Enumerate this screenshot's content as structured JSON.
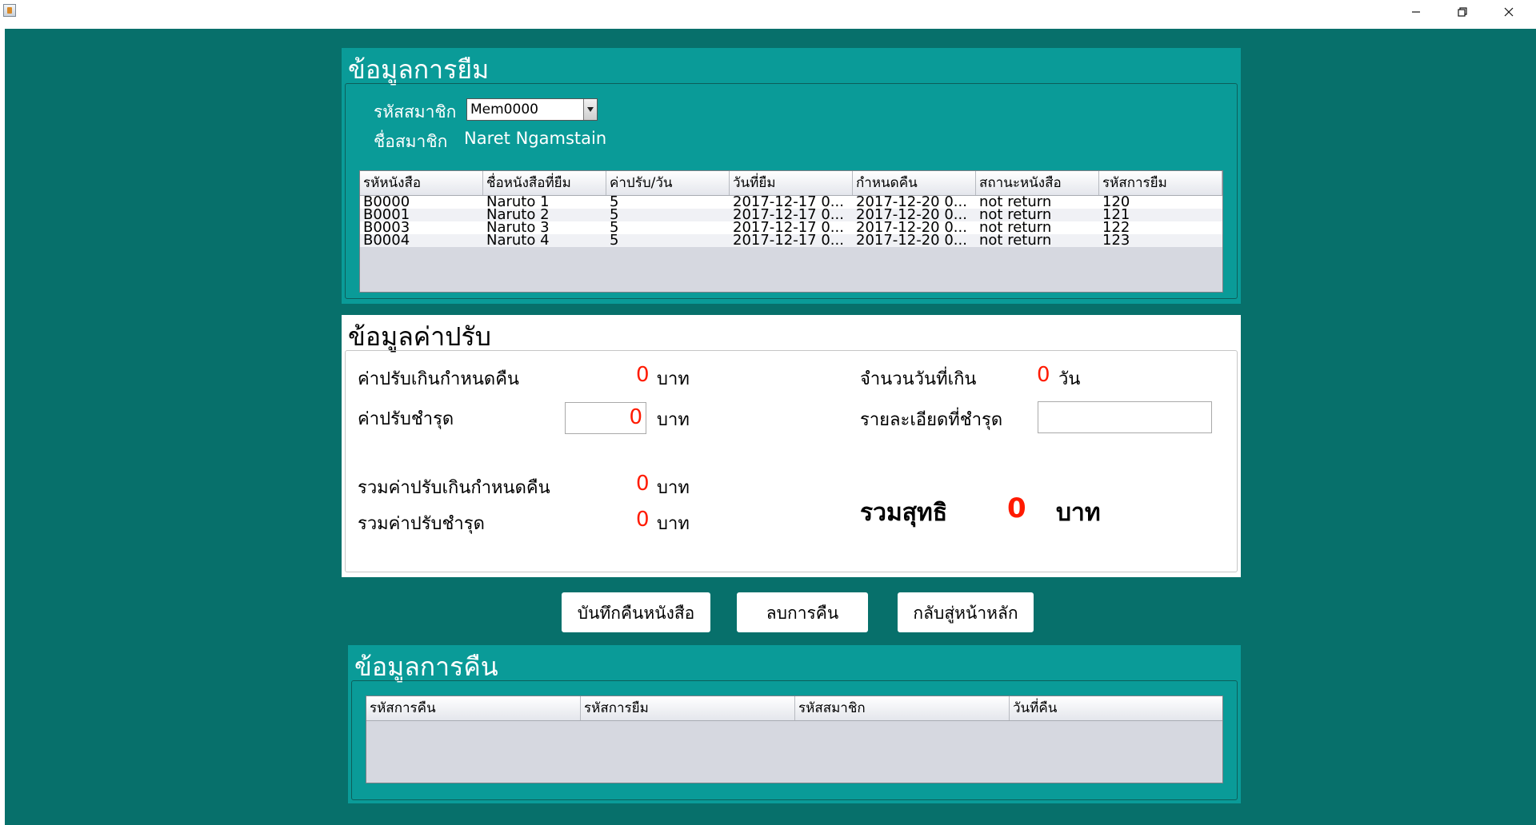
{
  "window": {
    "app_icon": "java-app-icon",
    "controls": {
      "minimize": "minimize-icon",
      "maximize": "restore-icon",
      "close": "close-icon"
    }
  },
  "borrow_panel": {
    "title": "ข้อมูลการยืม",
    "member_id_label": "รหัสสมาชิก",
    "member_id_value": "Mem0000",
    "member_name_label": "ชื่อสมาชิก",
    "member_name_value": "Naret Ngamstain",
    "columns": [
      "รหัหนังสือ",
      "ชื่อหนังสือที่ยืม",
      "ค่าปรับ/วัน",
      "วันที่ยืม",
      "กำหนดคืน",
      "สถานะหนังสือ",
      "รหัสการยืม"
    ],
    "rows": [
      [
        "B0000",
        "Naruto 1",
        "5",
        "2017-12-17 0...",
        "2017-12-20 0...",
        "not return",
        "120"
      ],
      [
        "B0001",
        "Naruto 2",
        "5",
        "2017-12-17 0...",
        "2017-12-20 0...",
        "not return",
        "121"
      ],
      [
        "B0003",
        "Naruto 3",
        "5",
        "2017-12-17 0...",
        "2017-12-20 0...",
        "not return",
        "122"
      ],
      [
        "B0004",
        "Naruto 4",
        "5",
        "2017-12-17 0...",
        "2017-12-20 0...",
        "not return",
        "123"
      ]
    ]
  },
  "fine_panel": {
    "title": "ข้อมูลค่าปรับ",
    "overdue_fine_label": "ค่าปรับเกินกำหนดคืน",
    "overdue_fine_value": "0",
    "damage_fine_label": "ค่าปรับชำรุด",
    "damage_fine_value": "0",
    "days_over_label": "จำนวนวันที่เกิน",
    "days_over_value": "0",
    "days_unit": "วัน",
    "damage_detail_label": "รายละเอียดที่ชำรุด",
    "damage_detail_value": "",
    "total_overdue_label": "รวมค่าปรับเกินกำหนดคืน",
    "total_overdue_value": "0",
    "total_damage_label": "รวมค่าปรับชำรุด",
    "total_damage_value": "0",
    "net_total_label": "รวมสุทธิ",
    "net_total_value": "0",
    "currency_unit": "บาท"
  },
  "actions": {
    "save_return": "บันทึกคืนหนังสือ",
    "delete_return": "ลบการคืน",
    "back_home": "กลับสู่หน้าหลัก"
  },
  "return_panel": {
    "title": "ข้อมูลการคืน",
    "columns": [
      "รหัสการคืน",
      "รหัสการยืม",
      "รหัสสมาชิก",
      "วันที่คืน"
    ],
    "rows": []
  },
  "colors": {
    "background": "#07706b",
    "panel_teal": "#0a9b98",
    "value_red": "#ff1a00"
  }
}
